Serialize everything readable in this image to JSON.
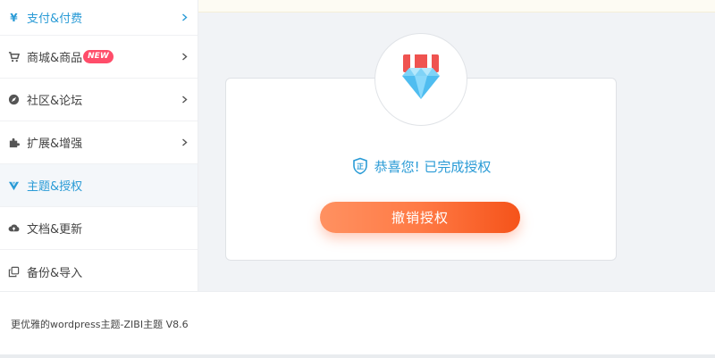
{
  "sidebar": {
    "items": [
      {
        "label": "支付&付费",
        "icon": "yen-icon",
        "has_arrow": true
      },
      {
        "label": "商城&商品",
        "icon": "cart-icon",
        "badge": "NEW",
        "has_arrow": true
      },
      {
        "label": "社区&论坛",
        "icon": "compass-icon",
        "has_arrow": true
      },
      {
        "label": "扩展&增强",
        "icon": "puzzle-icon",
        "has_arrow": true
      },
      {
        "label": "主题&授权",
        "icon": "theme-logo-icon",
        "has_arrow": false,
        "active": true
      },
      {
        "label": "文档&更新",
        "icon": "cloud-upload-icon",
        "has_arrow": false
      },
      {
        "label": "备份&导入",
        "icon": "copy-icon",
        "has_arrow": false
      }
    ]
  },
  "license": {
    "success_message": "恭喜您! 已完成授权",
    "revoke_button": "撤销授权"
  },
  "footer": {
    "text": "更优雅的wordpress主题-ZIBI主题 V8.6"
  },
  "colors": {
    "accent_blue": "#2a9bd6",
    "button_orange": "#ff7a45",
    "badge_red": "#ff4d6a"
  }
}
